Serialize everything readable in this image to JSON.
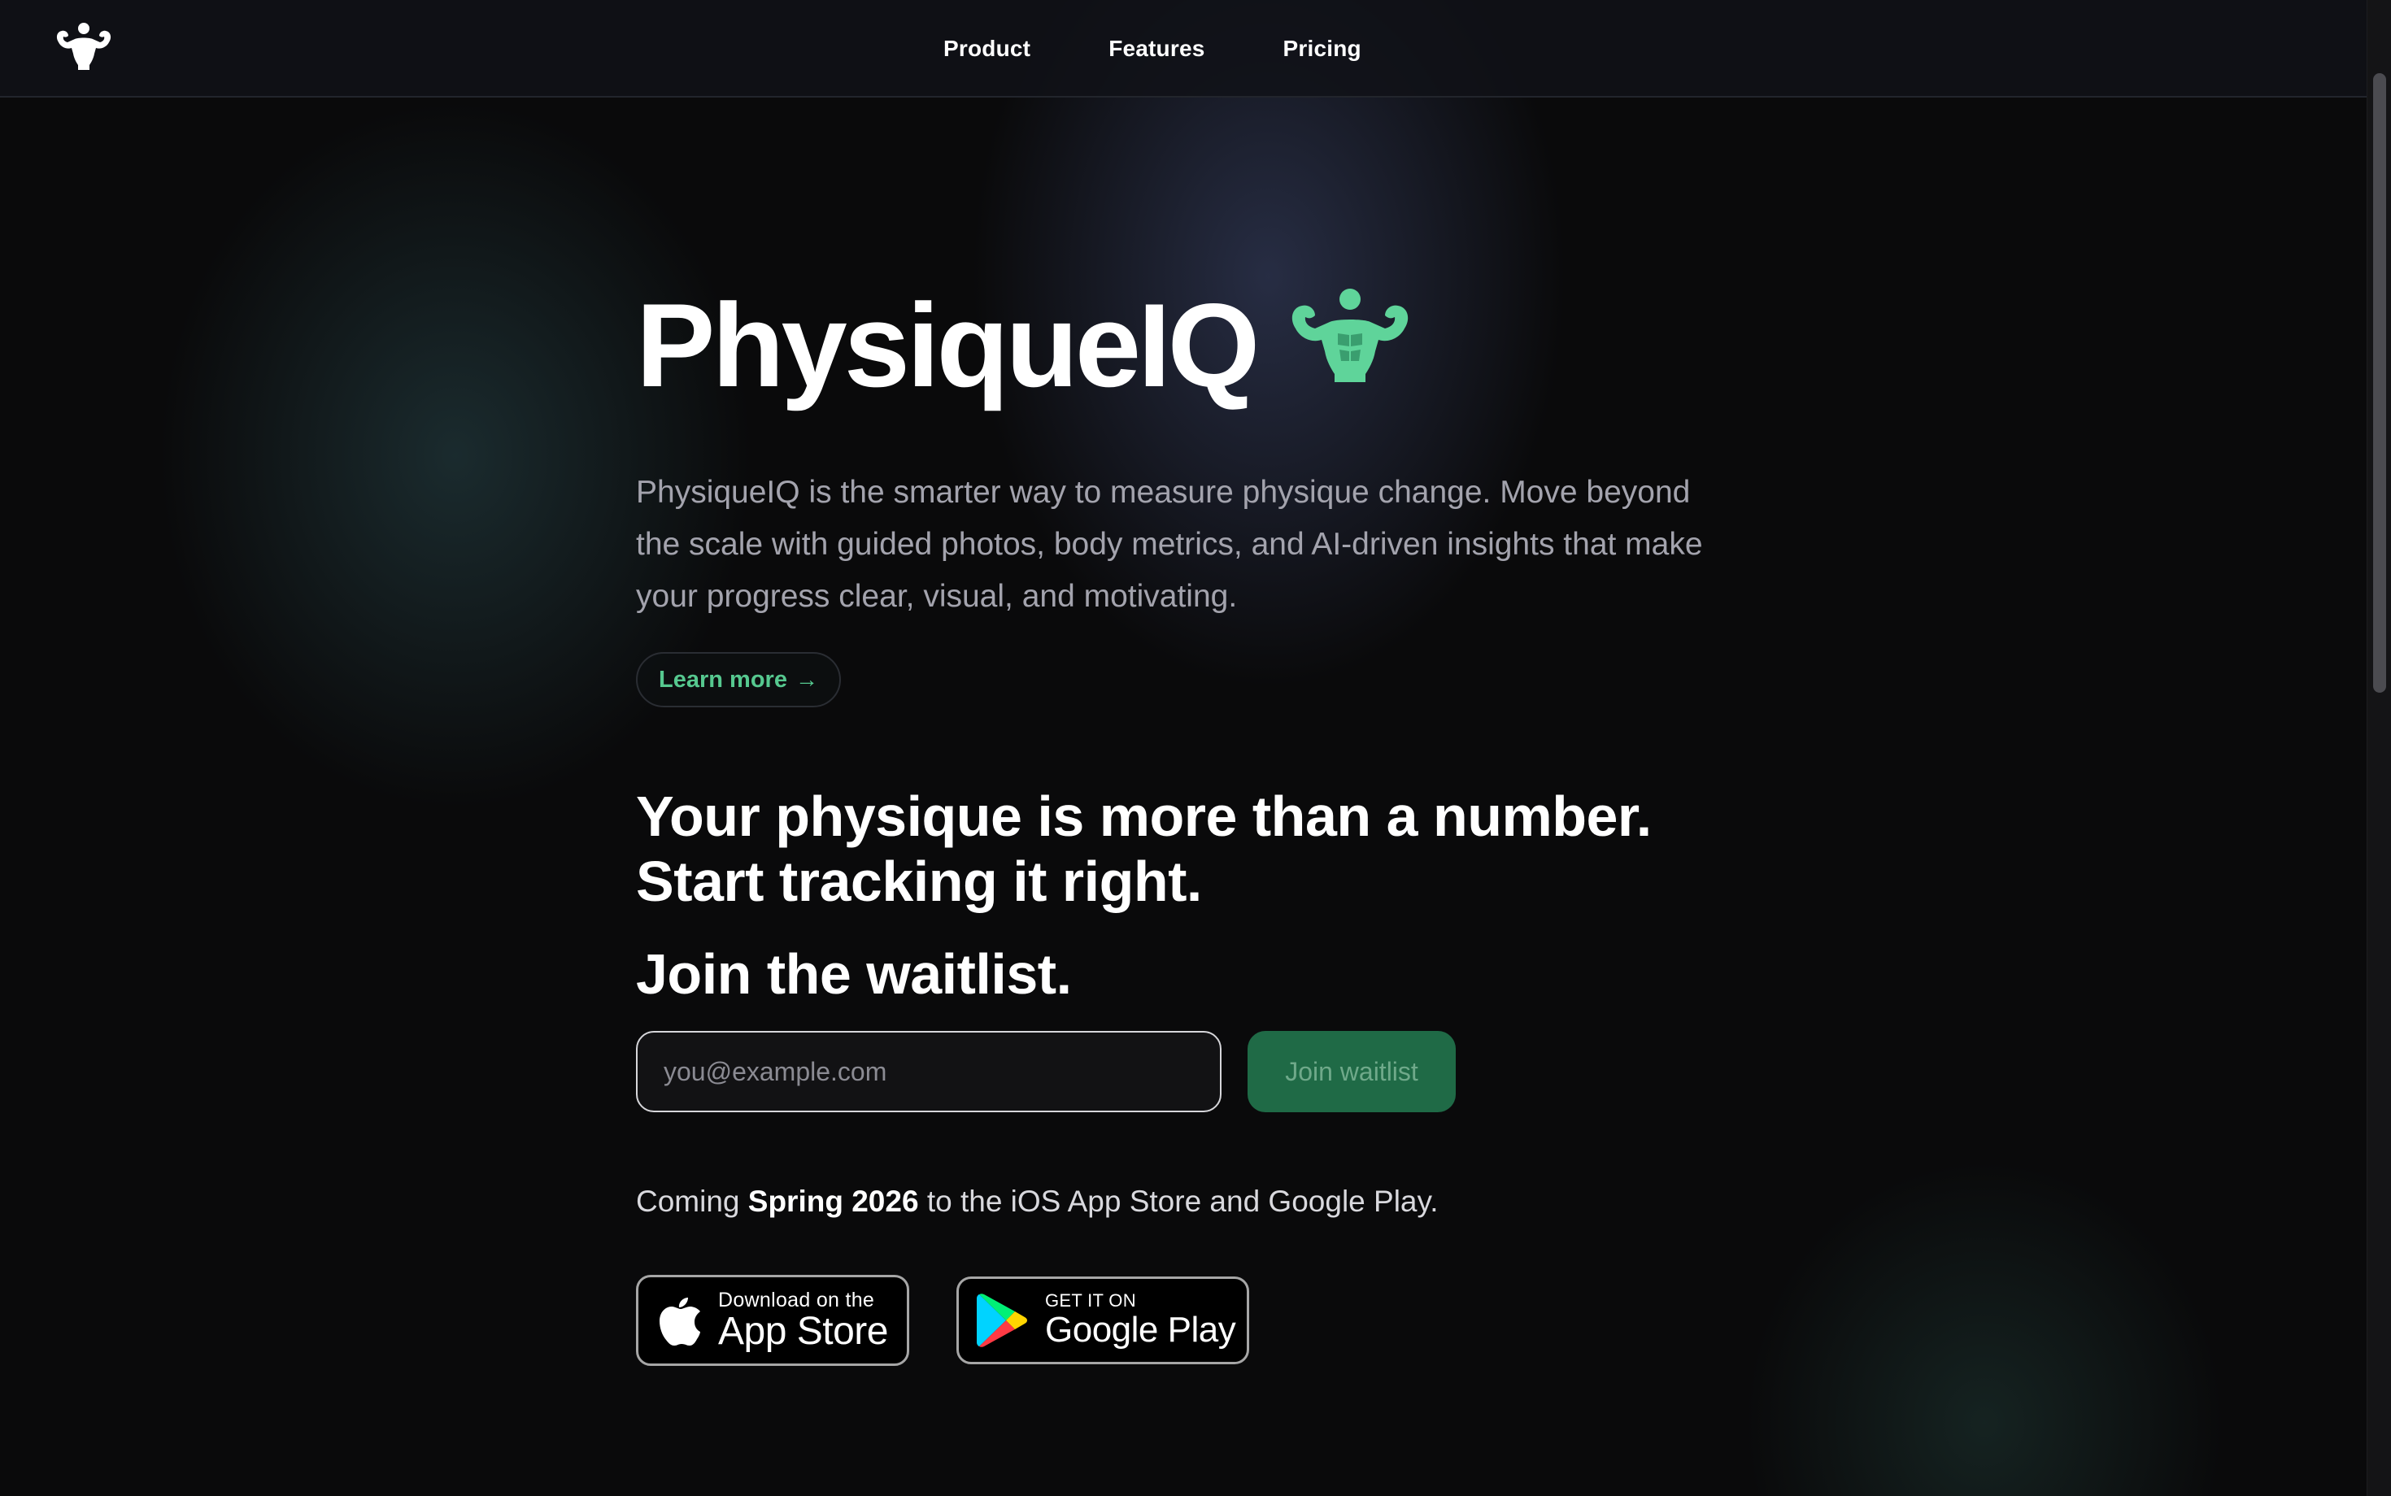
{
  "nav": {
    "logo_icon": "flexed-bodybuilder-icon",
    "links": [
      {
        "label": "Product"
      },
      {
        "label": "Features"
      },
      {
        "label": "Pricing"
      }
    ]
  },
  "hero": {
    "title": "PhysiqueIQ",
    "title_icon": "flexed-bodybuilder-icon",
    "description": "PhysiqueIQ is the smarter way to measure physique change. Move beyond the scale with guided photos, body metrics, and AI-driven insights that make your progress clear, visual, and motivating.",
    "learn_more_label": "Learn more",
    "learn_more_arrow": "→",
    "tagline_line1": "Your physique is more than a number.",
    "tagline_line2": "Start tracking it right.",
    "waitlist_heading": "Join the waitlist."
  },
  "waitlist_form": {
    "email_placeholder": "you@example.com",
    "email_value": "",
    "submit_label": "Join waitlist"
  },
  "launch": {
    "prefix": "Coming ",
    "highlight": "Spring 2026",
    "suffix": " to the iOS App Store and Google Play."
  },
  "store_badges": {
    "apple": {
      "small": "Download on the",
      "big": "App Store",
      "icon": "apple-logo-icon"
    },
    "google": {
      "small": "GET IT ON",
      "big": "Google Play",
      "icon": "google-play-logo-icon"
    }
  },
  "colors": {
    "background": "#0a0a0b",
    "accent_green": "#56c88f",
    "button_green": "#1f6a46",
    "muted_text": "#a3a3ad"
  }
}
